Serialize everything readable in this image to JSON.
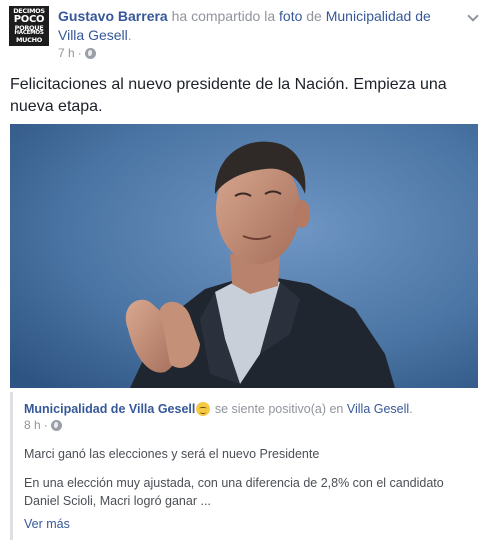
{
  "post": {
    "avatar_lines": [
      "DECIMOS",
      "POCO",
      "PORQUE",
      "HACEMOS",
      "MUCHO"
    ],
    "actor_name": "Gustavo Barrera",
    "share_text_1": "ha compartido la",
    "share_link_photo": "foto",
    "share_text_2": "de",
    "shared_from": "Municipalidad de Villa Gesell",
    "header_end": ".",
    "time": "7 h",
    "dot": "·",
    "privacy_icon": "globe-icon",
    "message": "Felicitaciones al nuevo presidente de la Nación. Empieza una nueva etapa."
  },
  "shared": {
    "page_name": "Municipalidad de Villa Gesell",
    "feeling_text": "se siente positivo(a) en",
    "place": "Villa Gesell",
    "end": ".",
    "time": "8 h",
    "dot": "·",
    "line1": "Marci ganó las elecciones y será el nuevo Presidente",
    "line2": "En una elección muy ajustada, con una diferencia de 2,8% con el candidato Daniel Scioli, Macri logró ganar ...",
    "see_more": "Ver más"
  },
  "colors": {
    "link": "#365899",
    "meta": "#90949c",
    "text": "#1d2129",
    "photo_bg": "#4c77a6"
  }
}
